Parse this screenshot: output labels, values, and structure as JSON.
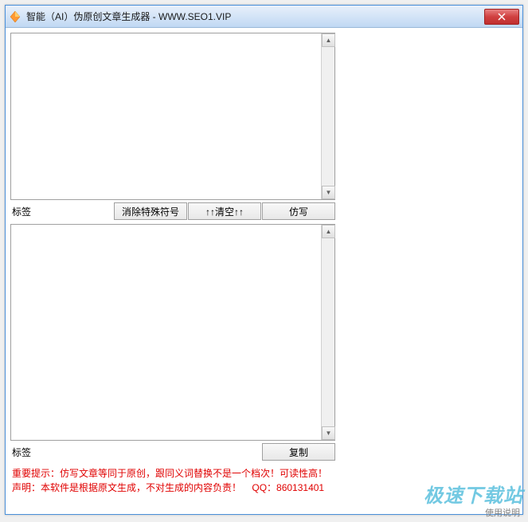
{
  "window": {
    "title": "智能（AI）伪原创文章生成器 - WWW.SEO1.VIP"
  },
  "input_panel": {
    "label": "标签",
    "value": ""
  },
  "output_panel": {
    "label": "标签",
    "value": ""
  },
  "buttons": {
    "remove_special": "消除特殊符号",
    "clear": "↑↑清空↑↑",
    "rewrite": "仿写",
    "copy": "复制"
  },
  "footer": {
    "line1": "重要提示：仿写文章等同于原创，跟同义词替换不是一个档次！可读性高！",
    "line2_prefix": "声明：本软件是根据原文生成，不对生成的内容负责！",
    "qq_label": "QQ：",
    "qq_number": "860131401"
  },
  "watermark": "极速下载站",
  "usage_note": "使用说明"
}
